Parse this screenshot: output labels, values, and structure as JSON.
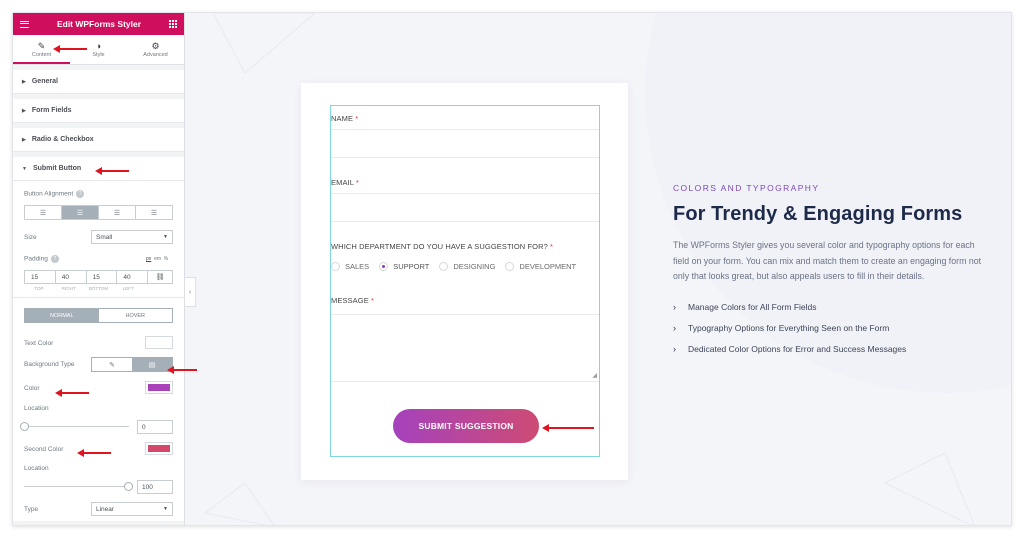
{
  "sidebar": {
    "title": "Edit WPForms Styler",
    "tabs": [
      {
        "label": "Content",
        "icon": "pencil-icon"
      },
      {
        "label": "Style",
        "icon": "half-circle-icon"
      },
      {
        "label": "Advanced",
        "icon": "gear-icon"
      }
    ],
    "sections": [
      "General",
      "Form Fields",
      "Radio & Checkbox"
    ],
    "submit_section": {
      "title": "Submit Button",
      "alignment_label": "Button Alignment",
      "size_label": "Size",
      "size_value": "Small",
      "padding_label": "Padding",
      "units": {
        "px": "px",
        "em": "em",
        "pct": "%"
      },
      "padding": {
        "top": "15",
        "right": "40",
        "bottom": "15",
        "left": "40"
      },
      "padding_sub": {
        "top": "TOP",
        "right": "RIGHT",
        "bottom": "BOTTOM",
        "left": "LEFT"
      },
      "state_tabs": {
        "normal": "NORMAL",
        "hover": "HOVER"
      },
      "text_color_label": "Text Color",
      "bg_type_label": "Background Type",
      "color_label": "Color",
      "color_value": "#a942b8",
      "location_label": "Location",
      "location_value": "0",
      "second_color_label": "Second Color",
      "second_color_value": "#d4486a",
      "location2_label": "Location",
      "location2_value": "100",
      "type_label": "Type",
      "type_value": "Linear"
    }
  },
  "form": {
    "name_label": "NAME",
    "email_label": "EMAIL",
    "dept_label": "WHICH DEPARTMENT DO YOU HAVE A SUGGESTION FOR?",
    "required_mark": "*",
    "options": [
      "SALES",
      "SUPPORT",
      "DESIGNING",
      "DEVELOPMENT"
    ],
    "selected_option": "SUPPORT",
    "message_label": "MESSAGE",
    "submit_label": "SUBMIT SUGGESTION"
  },
  "copy": {
    "eyebrow": "COLORS AND TYPOGRAPHY",
    "heading": "For Trendy & Engaging Forms",
    "paragraph": "The WPForms Styler gives you several color and typography options for each field on your form. You can mix and match them to create an engaging form not only that looks great, but also appeals users to fill in their details.",
    "bullets": [
      "Manage Colors for All Form Fields",
      "Typography Options for Everything Seen on the Form",
      "Dedicated Color Options for Error and Success Messages"
    ]
  },
  "colors": {
    "brand": "#cf0f5d",
    "accent": "#7b4bb6",
    "annotation_arrow": "#e0141f"
  }
}
